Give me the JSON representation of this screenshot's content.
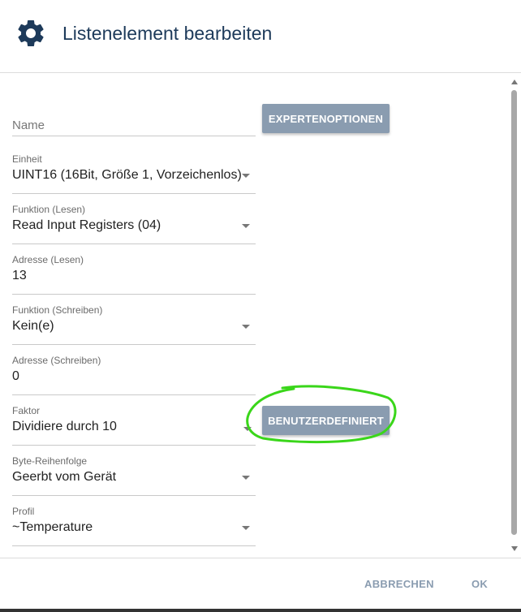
{
  "dialog": {
    "title": "Listenelement bearbeiten",
    "icon": "gear-icon"
  },
  "fields": {
    "name": {
      "placeholder": "Name",
      "value": ""
    },
    "einheit": {
      "label": "Einheit",
      "value": "UINT16 (16Bit, Größe 1, Vorzeichenlos)"
    },
    "funktion_lesen": {
      "label": "Funktion (Lesen)",
      "value": "Read Input Registers (04)"
    },
    "adresse_lesen": {
      "label": "Adresse (Lesen)",
      "value": "13"
    },
    "funktion_schreiben": {
      "label": "Funktion (Schreiben)",
      "value": "Kein(e)"
    },
    "adresse_schreiben": {
      "label": "Adresse (Schreiben)",
      "value": "0"
    },
    "faktor": {
      "label": "Faktor",
      "value": "Dividiere durch 10"
    },
    "byte_reihenfolge": {
      "label": "Byte-Reihenfolge",
      "value": "Geerbt vom Gerät"
    },
    "profil": {
      "label": "Profil",
      "value": "~Temperature"
    }
  },
  "buttons": {
    "expert": "EXPERTENOPTIONEN",
    "custom": "BENUTZERDEFINIERT",
    "cancel": "ABBRECHEN",
    "ok": "OK"
  },
  "colors": {
    "title": "#1d3a5a",
    "button_bg": "#8a9cb0",
    "highlight": "#3ad61a"
  }
}
